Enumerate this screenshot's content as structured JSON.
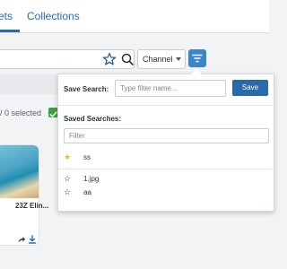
{
  "tabs": {
    "assets_label": "Assets",
    "collections_label": "Collections"
  },
  "search": {
    "channel_select": "Channel"
  },
  "results": {
    "selection_status": "/ 0 selected"
  },
  "asset_card": {
    "title": "23Z  Elin..."
  },
  "saved_searches_popover": {
    "save_search_label": "Save Search:",
    "filter_name_placeholder": "Type filter name...",
    "save_button": "Save",
    "saved_searches_heading": "Saved Searches:",
    "filter_placeholder": "Filter",
    "items": [
      {
        "name": "ss",
        "starred": true
      },
      {
        "name": "1.jpg",
        "starred": false
      },
      {
        "name": "aa",
        "starred": false
      }
    ]
  },
  "colors": {
    "accent": "#1f6fb2",
    "primary_button": "#2a6aa8",
    "filter_button": "#3a86c8",
    "star_gold": "#f0b92a",
    "check_green": "#3aa140"
  }
}
